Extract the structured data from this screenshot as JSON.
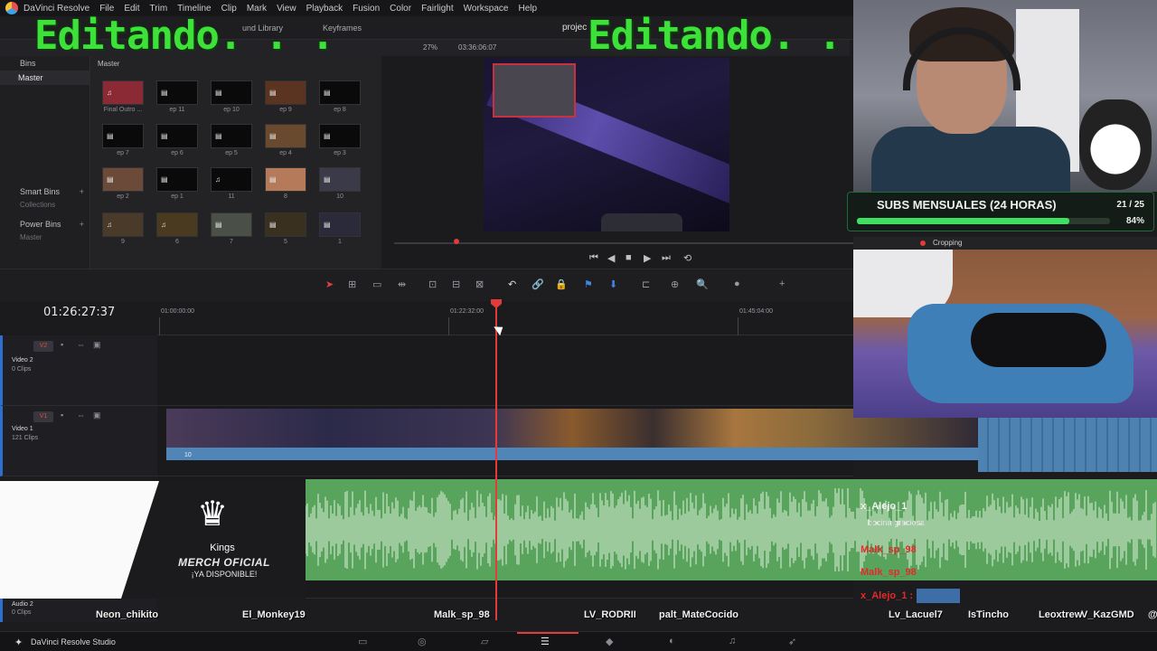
{
  "app": {
    "name": "DaVinci Resolve",
    "menu": [
      "File",
      "Edit",
      "Trim",
      "Timeline",
      "Clip",
      "Mark",
      "View",
      "Playback",
      "Fusion",
      "Color",
      "Fairlight",
      "Workspace",
      "Help"
    ]
  },
  "toolbar": {
    "library_label": "und Library",
    "keyframes_label": "Keyframes",
    "project_label": "projec"
  },
  "viewer": {
    "zoom": "27%",
    "timecode": "03:36:06:07"
  },
  "bins": {
    "header": "Bins",
    "master": "Master",
    "smart_bins": "Smart Bins",
    "collections": "Collections",
    "power_bins": "Power Bins",
    "power_master": "Master"
  },
  "pool": {
    "breadcrumb": "Master",
    "clips": [
      {
        "label": "Final Outro ..."
      },
      {
        "label": "ep 11"
      },
      {
        "label": "ep 10"
      },
      {
        "label": "ep 9"
      },
      {
        "label": "ep 8"
      },
      {
        "label": "ep 7"
      },
      {
        "label": "ep 6"
      },
      {
        "label": "ep 5"
      },
      {
        "label": "ep 4"
      },
      {
        "label": "ep 3"
      },
      {
        "label": "ep 2"
      },
      {
        "label": "ep 1"
      },
      {
        "label": "11"
      },
      {
        "label": "8"
      },
      {
        "label": "10"
      },
      {
        "label": "9"
      },
      {
        "label": "6"
      },
      {
        "label": "7"
      },
      {
        "label": "5"
      },
      {
        "label": "1"
      }
    ]
  },
  "timeline": {
    "current_tc": "01:26:27:37",
    "ruler": [
      "01:00:00:00",
      "01:22:32:00",
      "01:45:04:00"
    ],
    "tracks": {
      "v2": {
        "tag": "V2",
        "name": "Video 2",
        "clips": "0 Clips"
      },
      "v1": {
        "tag": "V1",
        "name": "Video 1",
        "clips": "121 Clips"
      },
      "a2": {
        "name": "Audio 2",
        "clips": "0 Clips"
      }
    },
    "v1_clip_count": "10"
  },
  "overlay": {
    "editando_left": "Editando. . .",
    "editando_right": "Editando. . .",
    "subs_title": "SUBS MENSUALES (24 HORAS)",
    "subs_count": "21 / 25",
    "subs_pct": "84%",
    "subs_progress": 0.84,
    "cropping_label": "Cropping",
    "merch": {
      "brand": "Kings",
      "line1": "MERCH OFICIAL",
      "line2": "¡YA DISPONIBLE!"
    },
    "chat": [
      {
        "user": "x_Alejo_1",
        "msg": "bocina graciosa"
      },
      {
        "user": "Malk_sp_98",
        "msg": ""
      },
      {
        "user": "Malk_sp_98",
        "msg": ""
      },
      {
        "user": "x_Alejo_1 :",
        "msg": ""
      }
    ],
    "viewer_names": [
      "Neon_chikito",
      "El_Monkey19",
      "Malk_sp_98",
      "LV_RODRII",
      "palt_MateCocido",
      "Lv_Lacuel7",
      "IsTincho",
      "Leoxtrew",
      "V_KazGMD",
      "@"
    ]
  },
  "taskbar": {
    "app_label": "DaVinci Resolve Studio"
  },
  "colors": {
    "accent_red": "#e23b3b",
    "track_blue": "#4f86b7",
    "audio_green": "#58a45c",
    "overlay_green": "#3ee03a"
  }
}
